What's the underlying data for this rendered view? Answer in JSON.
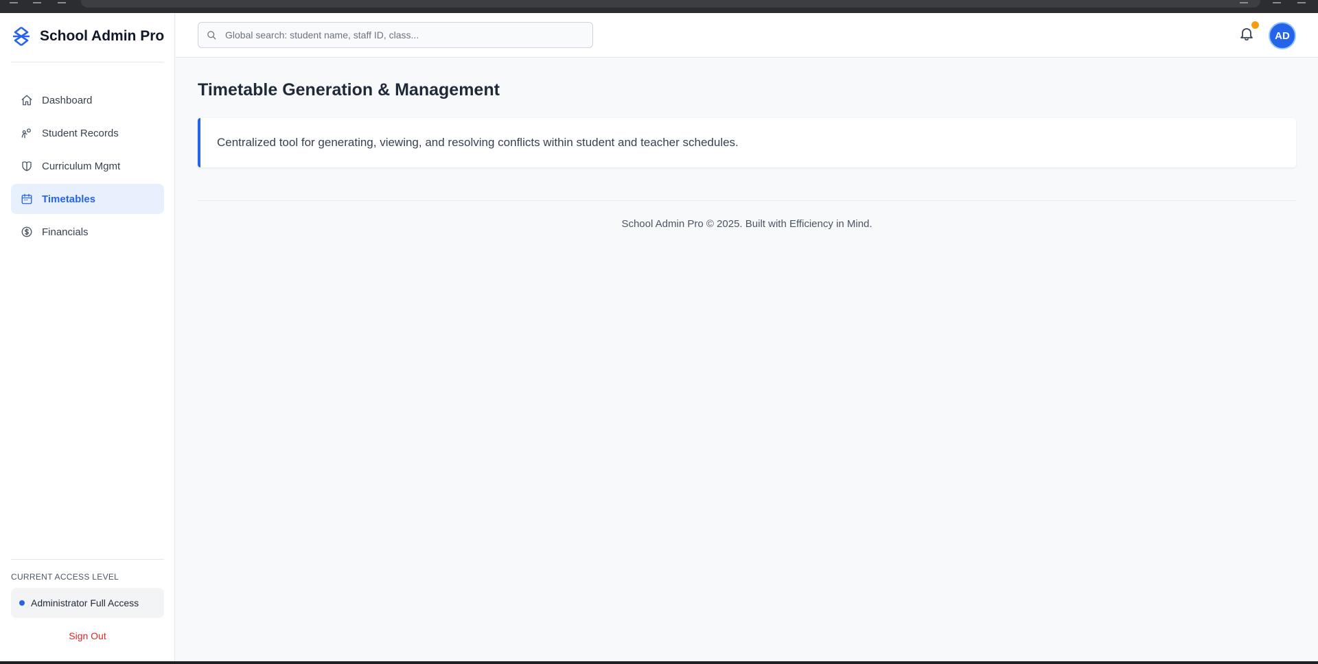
{
  "app": {
    "name": "School Admin Pro"
  },
  "sidebar": {
    "items": [
      {
        "label": "Dashboard",
        "icon": "home-icon",
        "active": false
      },
      {
        "label": "Student Records",
        "icon": "students-icon",
        "active": false
      },
      {
        "label": "Curriculum Mgmt",
        "icon": "curriculum-icon",
        "active": false
      },
      {
        "label": "Timetables",
        "icon": "calendar-icon",
        "active": true
      },
      {
        "label": "Financials",
        "icon": "dollar-circle-icon",
        "active": false
      }
    ],
    "access_heading": "CURRENT ACCESS LEVEL",
    "access_level": "Administrator Full Access",
    "sign_out": "Sign Out"
  },
  "header": {
    "search_placeholder": "Global search: student name, staff ID, class...",
    "avatar_initials": "AD",
    "notification_indicator": true
  },
  "main": {
    "title": "Timetable Generation & Management",
    "description": "Centralized tool for generating, viewing, and resolving conflicts within student and teacher schedules.",
    "footer": "School Admin Pro © 2025. Built with Efficiency in Mind."
  },
  "colors": {
    "accent": "#2563eb",
    "active_bg": "#e8f0fd",
    "notification": "#f59e0b",
    "danger": "#dc2626"
  }
}
